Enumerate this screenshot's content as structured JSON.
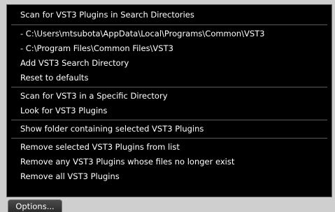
{
  "menu": {
    "groups": [
      {
        "items": [
          "Scan for VST3 Plugins in Search Directories"
        ]
      },
      {
        "items": [
          "- C:\\Users\\mtsubota\\AppData\\Local\\Programs\\Common\\VST3",
          "- C:\\Program Files\\Common Files\\VST3",
          "Add VST3 Search Directory",
          "Reset to defaults"
        ]
      },
      {
        "items": [
          "Scan for VST3 in a Specific Directory",
          "Look for VST3 Plugins"
        ]
      },
      {
        "items": [
          "Show folder containing selected VST3 Plugins"
        ]
      },
      {
        "items": [
          "Remove selected VST3 Plugins from list",
          "Remove any VST3 Plugins whose files no longer exist",
          "Remove all VST3 Plugins"
        ]
      }
    ]
  },
  "options_button": {
    "label": "Options..."
  }
}
